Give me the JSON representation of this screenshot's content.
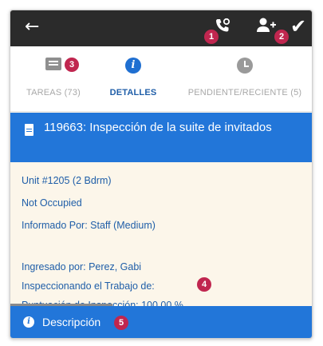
{
  "topbar": {
    "back_icon": "arrow-left-icon",
    "phone_icon": "phone-settings-icon",
    "add_user_icon": "add-user-icon",
    "check_icon": "check-icon",
    "badge_1": "1",
    "badge_2": "2"
  },
  "tabs": [
    {
      "label": "TAREAS (73)",
      "icon": "list-icon",
      "badge": "3",
      "active": false
    },
    {
      "label": "DETALLES",
      "icon": "info-icon",
      "active": true
    },
    {
      "label": "PENDIENTE/RECIENTE (5)",
      "icon": "clock-icon",
      "active": false
    }
  ],
  "title": {
    "text": "119663: Inspección de la suite de invitados",
    "icon": "document-icon"
  },
  "details": {
    "unit": "Unit #1205 (2 Bdrm)",
    "occupancy": "Not Occupied",
    "reported_by": "Informado Por: Staff  (Medium)",
    "entered_by": "Ingresado por: Perez, Gabi",
    "inspecting": "Inspeccionando el Trabajo de:",
    "inspecting_badge": "4",
    "score": "Puntuación de Inspección: 100.00 %"
  },
  "footer": {
    "label": "Descripción",
    "icon": "info-icon",
    "badge": "5"
  },
  "colors": {
    "topbar": "#2b2b2b",
    "accent_blue": "#2276d9",
    "badge": "#c0264f",
    "detail_text": "#1f5ea8",
    "detail_bg": "#fcf6ea"
  }
}
